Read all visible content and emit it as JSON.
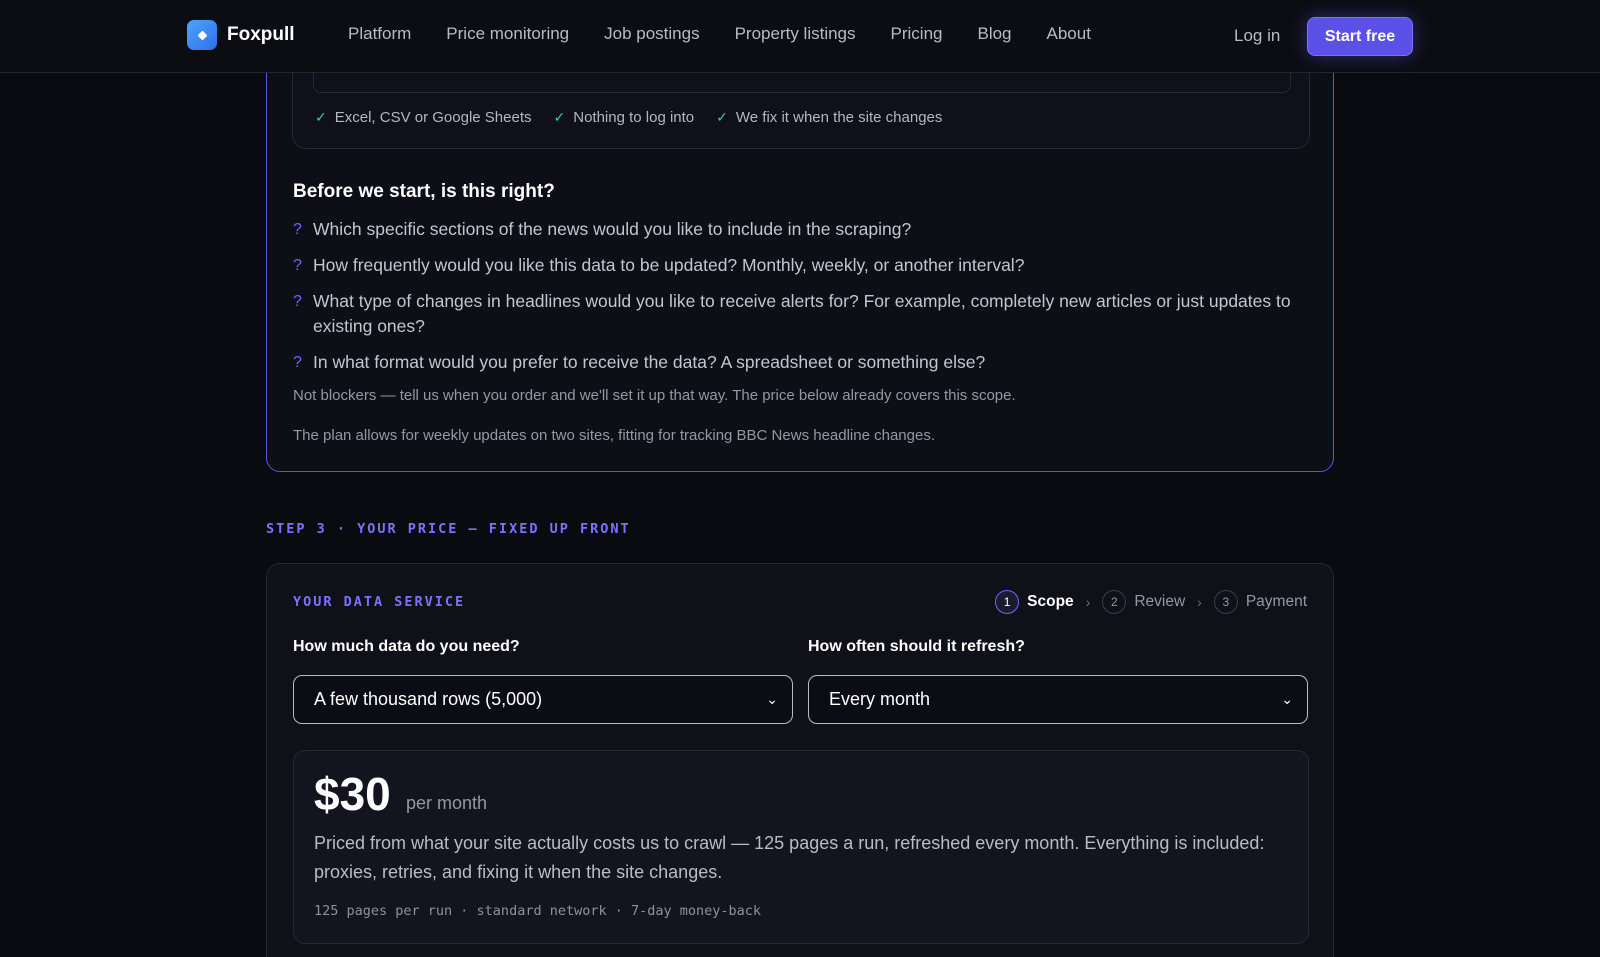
{
  "nav": {
    "brand": "Foxpull",
    "links": [
      "Platform",
      "Price monitoring",
      "Job postings",
      "Property listings",
      "Pricing",
      "Blog",
      "About"
    ],
    "login": "Log in",
    "cta": "Start free"
  },
  "scope": {
    "checks": [
      "Excel, CSV or Google Sheets",
      "Nothing to log into",
      "We fix it when the site changes"
    ],
    "title": "Before we start, is this right?",
    "question_mark": "?",
    "questions": [
      "Which specific sections of the news would you like to include in the scraping?",
      "How frequently would you like this data to be updated? Monthly, weekly, or another interval?",
      "What type of changes in headlines would you like to receive alerts for? For example, completely new articles or just updates to existing ones?",
      "In what format would you prefer to receive the data? A spreadsheet or something else?"
    ],
    "note_blockers": "Not blockers — tell us when you order and we'll set it up that way. The price below already covers this scope.",
    "note_plan": "The plan allows for weekly updates on two sites, fitting for tracking BBC News headline changes."
  },
  "step3": {
    "label": "STEP 3 · YOUR PRICE — FIXED UP FRONT"
  },
  "service": {
    "label": "YOUR DATA SERVICE",
    "steps": [
      {
        "num": "1",
        "name": "Scope"
      },
      {
        "num": "2",
        "name": "Review"
      },
      {
        "num": "3",
        "name": "Payment"
      }
    ],
    "data_label": "How much data do you need?",
    "data_value": "A few thousand rows (5,000)",
    "refresh_label": "How often should it refresh?",
    "refresh_value": "Every month",
    "price": "$30",
    "price_unit": "per month",
    "price_desc": "Priced from what your site actually costs us to crawl — 125 pages a run, refreshed every month. Everything is included: proxies, retries, and fixing it when the site changes.",
    "price_meta": "125 pages per run · standard network · 7-day money-back"
  },
  "icons": {
    "check": "check-icon",
    "chevron": "chevron-down-icon",
    "step_sep": "chevron-right-icon"
  },
  "colors": {
    "accent": "#5b50e8",
    "check": "#3ecf8e",
    "background": "#0a0b10"
  }
}
